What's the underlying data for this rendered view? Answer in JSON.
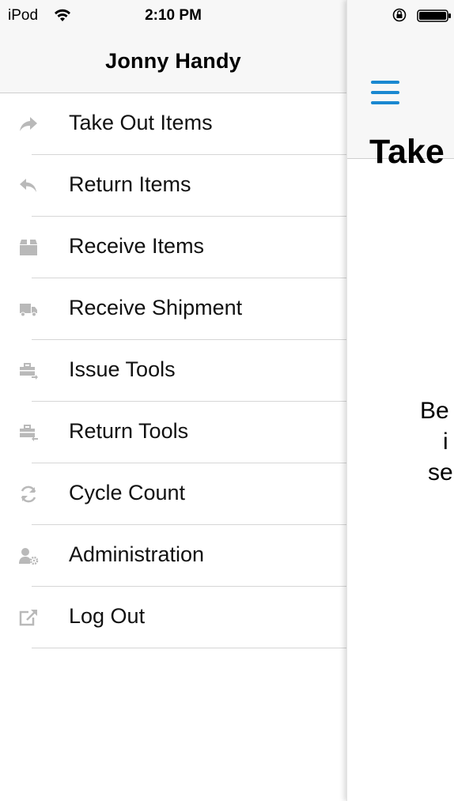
{
  "status_bar": {
    "carrier": "iPod",
    "time": "2:10 PM"
  },
  "drawer": {
    "title": "Jonny Handy",
    "items": [
      {
        "label": "Take Out Items",
        "icon": "share-arrow-icon"
      },
      {
        "label": "Return Items",
        "icon": "reply-arrow-icon"
      },
      {
        "label": "Receive Items",
        "icon": "box-icon"
      },
      {
        "label": "Receive Shipment",
        "icon": "truck-icon"
      },
      {
        "label": "Issue Tools",
        "icon": "toolbox-out-icon"
      },
      {
        "label": "Return Tools",
        "icon": "toolbox-return-icon"
      },
      {
        "label": "Cycle Count",
        "icon": "refresh-icon"
      },
      {
        "label": "Administration",
        "icon": "user-gear-icon"
      },
      {
        "label": "Log Out",
        "icon": "external-link-icon"
      }
    ]
  },
  "main": {
    "title": "Take",
    "body_lines": [
      "Be",
      "i",
      "se"
    ]
  },
  "colors": {
    "accent": "#1a88d0",
    "icon_gray": "#b9b9b9",
    "header_bg": "#f7f7f7"
  }
}
